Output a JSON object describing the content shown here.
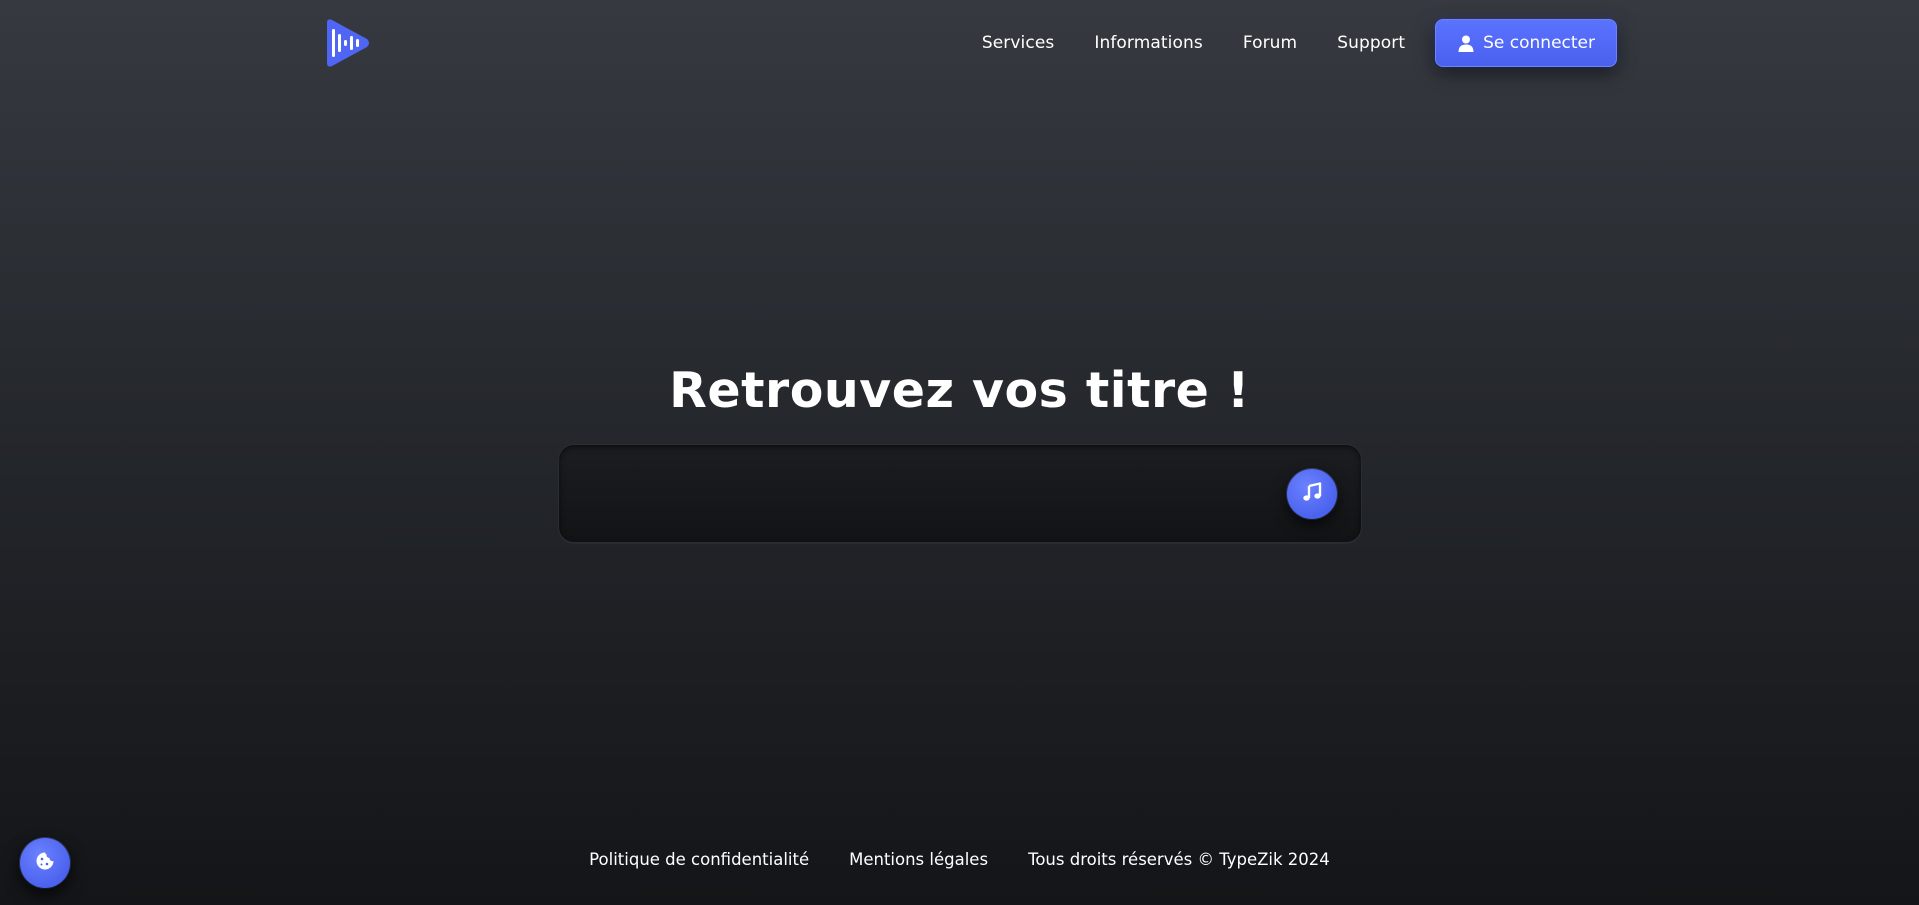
{
  "header": {
    "logo_icon": "soundwave-play-logo",
    "nav": [
      {
        "label": "Services"
      },
      {
        "label": "Informations"
      },
      {
        "label": "Forum"
      },
      {
        "label": "Support"
      }
    ],
    "login_button": {
      "label": "Se connecter",
      "icon": "user-icon"
    }
  },
  "hero": {
    "title": "Retrouvez vos titre !",
    "search": {
      "value": "",
      "placeholder": "",
      "button_icon": "music-note-icon"
    }
  },
  "footer": {
    "links": [
      {
        "label": "Politique de confidentialité"
      },
      {
        "label": "Mentions légales"
      }
    ],
    "copyright": "Tous droits réservés © TypeZik 2024"
  },
  "cookie_button": {
    "icon": "cookie-icon"
  },
  "colors": {
    "accent": "#4f66f5",
    "background_top": "#363a40",
    "background_bottom": "#141518",
    "text": "#ffffff"
  }
}
